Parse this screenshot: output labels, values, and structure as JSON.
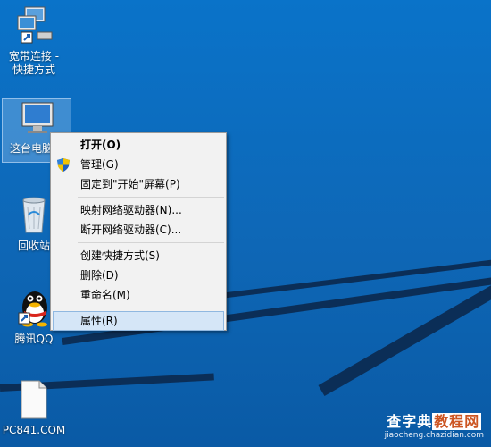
{
  "desktop": {
    "icons": [
      {
        "label_line1": "宽带连接 -",
        "label_line2": "快捷方式"
      },
      {
        "label": "这台电脑"
      },
      {
        "label": "回收站"
      },
      {
        "label": "腾讯QQ"
      },
      {
        "label": "PC841.COM"
      }
    ]
  },
  "context_menu": {
    "items": [
      {
        "label": "打开(O)"
      },
      {
        "label": "管理(G)"
      },
      {
        "label": "固定到\"开始\"屏幕(P)"
      },
      {
        "label": "映射网络驱动器(N)..."
      },
      {
        "label": "断开网络驱动器(C)..."
      },
      {
        "label": "创建快捷方式(S)"
      },
      {
        "label": "删除(D)"
      },
      {
        "label": "重命名(M)"
      },
      {
        "label": "属性(R)"
      }
    ]
  },
  "watermark": {
    "part1": "查字典",
    "part2": "教程网",
    "url": "jiaocheng.chazidian.com"
  },
  "colors": {
    "desktop_bg": "#0e67b6",
    "menu_bg": "#f2f2f2",
    "menu_highlight": "#d5e6f7"
  }
}
